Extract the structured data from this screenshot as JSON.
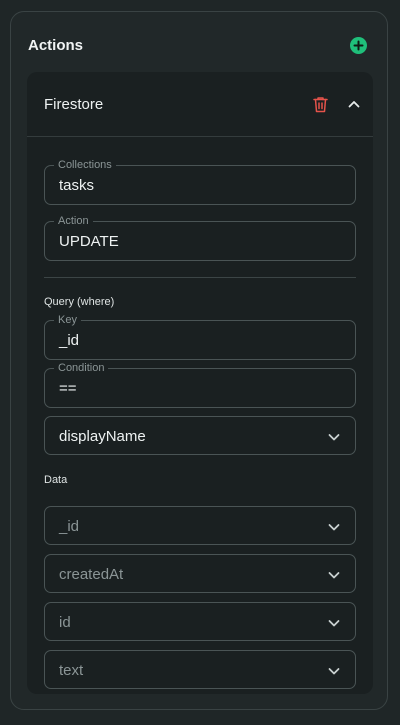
{
  "panel": {
    "title": "Actions",
    "add_icon": "plus-circle-icon",
    "accent": "#1fbf7a"
  },
  "card": {
    "title": "Firestore",
    "delete_icon": "trash-icon",
    "delete_color": "#e5534b",
    "collapse_icon": "chevron-up-icon"
  },
  "fields": {
    "collections": {
      "label": "Collections",
      "value": "tasks"
    },
    "action": {
      "label": "Action",
      "value": "UPDATE"
    }
  },
  "query": {
    "section_label": "Query (where)",
    "key": {
      "label": "Key",
      "value": "_id"
    },
    "condition": {
      "label": "Condition",
      "value": "=="
    },
    "value_select": "displayName"
  },
  "data": {
    "section_label": "Data",
    "rows": [
      "_id",
      "createdAt",
      "id",
      "text"
    ]
  }
}
